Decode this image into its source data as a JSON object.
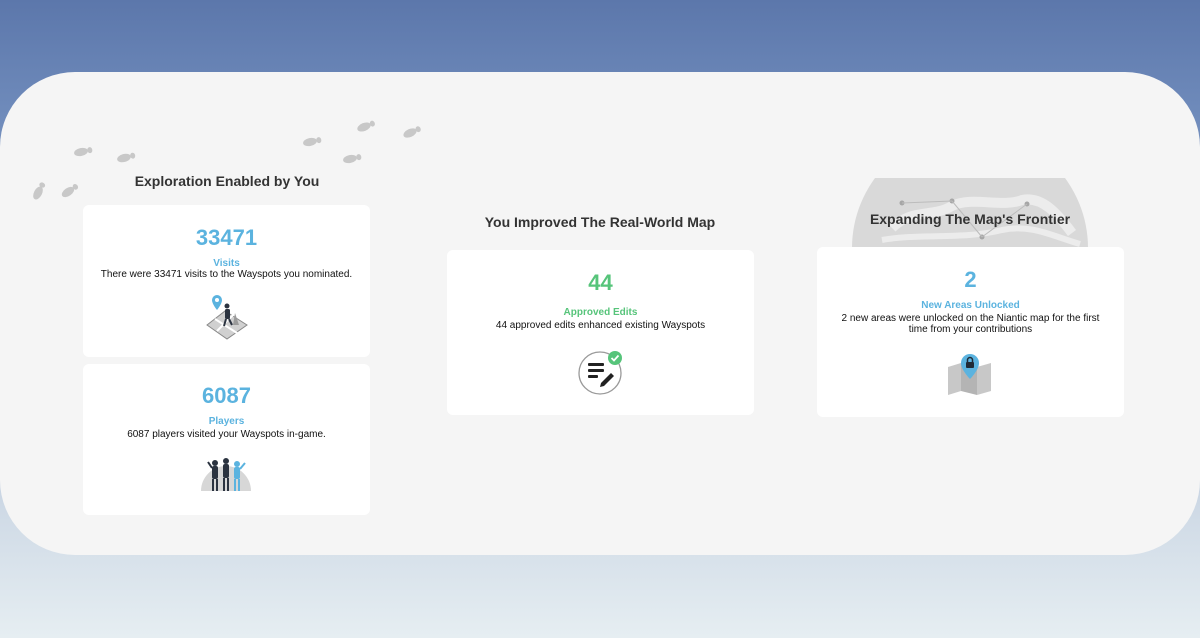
{
  "colors": {
    "blue_accent": "#5bb3df",
    "green_accent": "#56c47a",
    "title_text": "#333333",
    "body_text": "#111111",
    "panel_bg": "#f5f5f5",
    "card_bg": "#ffffff"
  },
  "exploration": {
    "title": "Exploration Enabled by You",
    "visits": {
      "value": "33471",
      "label": "Visits",
      "description": "There were 33471 visits to the Wayspots you nominated.",
      "icon": "walking-person-map-icon"
    },
    "players": {
      "value": "6087",
      "label": "Players",
      "description": "6087 players visited your Wayspots in-game.",
      "icon": "group-of-players-icon"
    }
  },
  "improved": {
    "title": "You Improved The Real-World Map",
    "edits": {
      "value": "44",
      "label": "Approved Edits",
      "description": "44 approved edits enhanced existing Wayspots",
      "icon": "edit-document-check-icon"
    }
  },
  "frontier": {
    "title": "Expanding The Map's Frontier",
    "areas": {
      "value": "2",
      "label": "New Areas Unlocked",
      "description": "2 new areas were unlocked on the Niantic map for the first time from your contributions",
      "icon": "map-lock-pin-icon"
    }
  }
}
